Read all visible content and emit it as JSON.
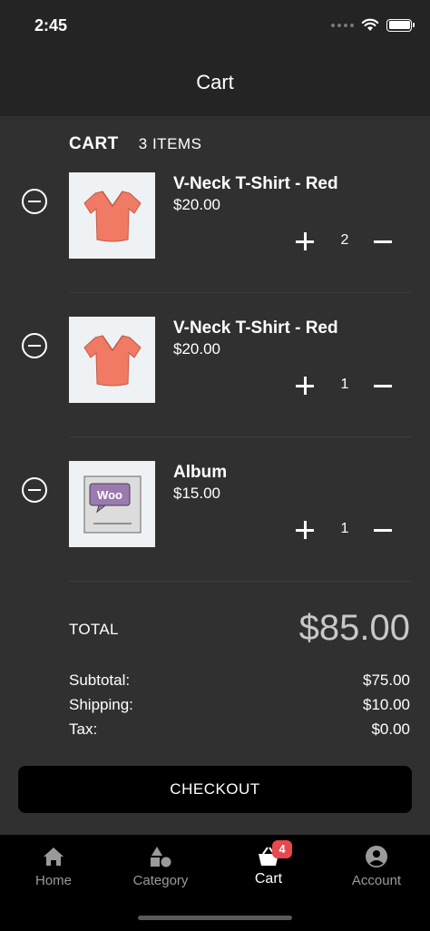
{
  "status": {
    "time": "2:45"
  },
  "nav": {
    "title": "Cart"
  },
  "cart": {
    "label": "CART",
    "count": "3 ITEMS"
  },
  "items": [
    {
      "name": "V-Neck T-Shirt - Red",
      "price": "$20.00",
      "quantity": "2",
      "image": "red-tshirt"
    },
    {
      "name": "V-Neck T-Shirt - Red",
      "price": "$20.00",
      "quantity": "1",
      "image": "red-tshirt"
    },
    {
      "name": "Album",
      "price": "$15.00",
      "quantity": "1",
      "image": "woo-album",
      "image_text": "Woo"
    }
  ],
  "totals": {
    "label": "TOTAL",
    "value": "$85.00",
    "subtotal_label": "Subtotal:",
    "subtotal": "$75.00",
    "shipping_label": "Shipping:",
    "shipping": "$10.00",
    "tax_label": "Tax:",
    "tax": "$0.00"
  },
  "checkout": {
    "label": "CHECKOUT"
  },
  "tabs": [
    {
      "label": "Home",
      "icon": "home-icon",
      "active": false
    },
    {
      "label": "Category",
      "icon": "category-icon",
      "active": false
    },
    {
      "label": "Cart",
      "icon": "cart-icon",
      "active": true,
      "badge": "4"
    },
    {
      "label": "Account",
      "icon": "account-icon",
      "active": false
    }
  ],
  "colors": {
    "background": "#303030",
    "bar": "#242424",
    "badge": "#e5484d",
    "shirt": "#f07a63"
  }
}
